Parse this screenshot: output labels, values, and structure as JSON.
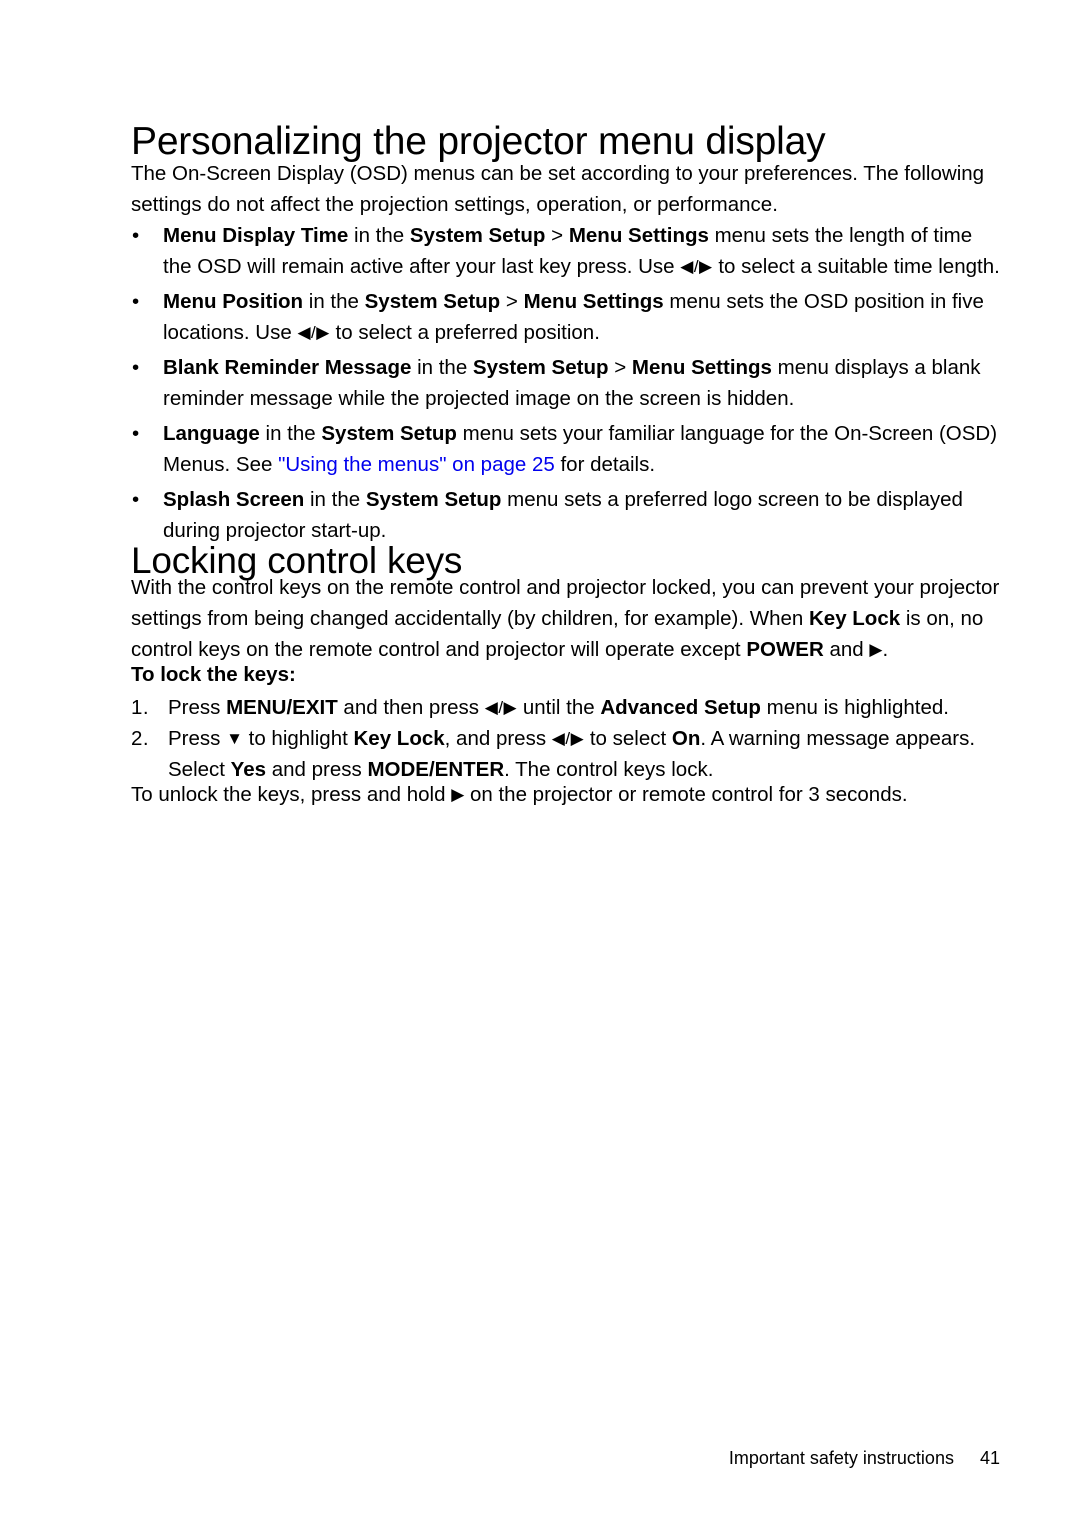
{
  "document": {
    "section_title": "Personalizing the projector menu display",
    "intro_paragraph": "The On-Screen Display (OSD) menus can be set according to your preferences. The following settings do not affect the projection settings, operation, or performance.",
    "bullet_marker": "•",
    "arrow_left_right": "◀/▶",
    "arrow_right": "▶",
    "arrow_down": "▼",
    "link_color": "#0000ee",
    "text_color": "#000000",
    "background_color": "#ffffff"
  },
  "bullets": [
    {
      "term": "Menu Display Time",
      "t1": " in the ",
      "menu1": "System Setup",
      "sep": " > ",
      "menu2": "Menu Settings",
      "t2": " menu sets the length of time the OSD will remain active after your last key press. Use ",
      "arrows": "◀/▶",
      "t3": " to select a suitable time length."
    },
    {
      "term": "Menu Position",
      "t1": " in the ",
      "menu1": "System Setup",
      "sep": " > ",
      "menu2": "Menu Settings",
      "t2": " menu sets the OSD position in five locations. Use ",
      "arrows": "◀/▶",
      "t3": " to select a preferred position."
    },
    {
      "term": "Blank Reminder Message",
      "t1": " in the ",
      "menu1": "System Setup",
      "sep": " > ",
      "menu2": "Menu Settings",
      "t2": " menu displays a blank reminder message while the projected image on the screen is hidden.",
      "arrows": "",
      "t3": ""
    },
    {
      "term": "Language",
      "t1": " in the ",
      "menu1": "System Setup",
      "sep": "",
      "menu2": "",
      "t2": " menu sets your familiar language for the On-Screen (OSD) Menus. See ",
      "link_text": "\"Using the menus\" on page 25",
      "t3": " for details."
    },
    {
      "term": "Splash Screen",
      "t1": " in the ",
      "menu1": "System Setup",
      "sep": "",
      "menu2": "",
      "t2": " menu sets a preferred logo screen to be displayed during projector start-up.",
      "arrows": "",
      "t3": ""
    }
  ],
  "locking": {
    "heading": "Locking control keys",
    "intro_a": "With the control keys on the remote control and projector locked, you can prevent your projector settings from being changed accidentally (by children, for example). When ",
    "key_lock": "Key Lock",
    "intro_b": " is on, no control keys on the remote control and projector will operate except ",
    "power": "POWER",
    "intro_c": " and ",
    "arrow_right": "▶",
    "intro_d": ".",
    "subheading": "To lock the keys:",
    "steps": [
      {
        "number": "1.",
        "a": "Press ",
        "b1": "MENU/EXIT",
        "c": " and then press ",
        "arrows": "◀/▶",
        "d": " until the ",
        "b2": "Advanced Setup",
        "e": " menu is highlighted."
      },
      {
        "number": "2.",
        "a": "Press ",
        "arrow_down": "▼",
        "b": " to highlight ",
        "b1": "Key Lock",
        "c": ", and press ",
        "arrows": "◀/▶",
        "d": " to select ",
        "b2": "On",
        "e": ". A warning message appears. Select ",
        "b3": "Yes",
        "f": " and press ",
        "b4": "MODE/ENTER",
        "g": ". The control keys lock."
      }
    ],
    "unlock_a": "To unlock the keys, press and hold ",
    "unlock_arrow": "▶",
    "unlock_b": " on the projector or remote control for 3 seconds."
  },
  "footer": {
    "chapter": "Important safety instructions",
    "page_number": "41"
  }
}
